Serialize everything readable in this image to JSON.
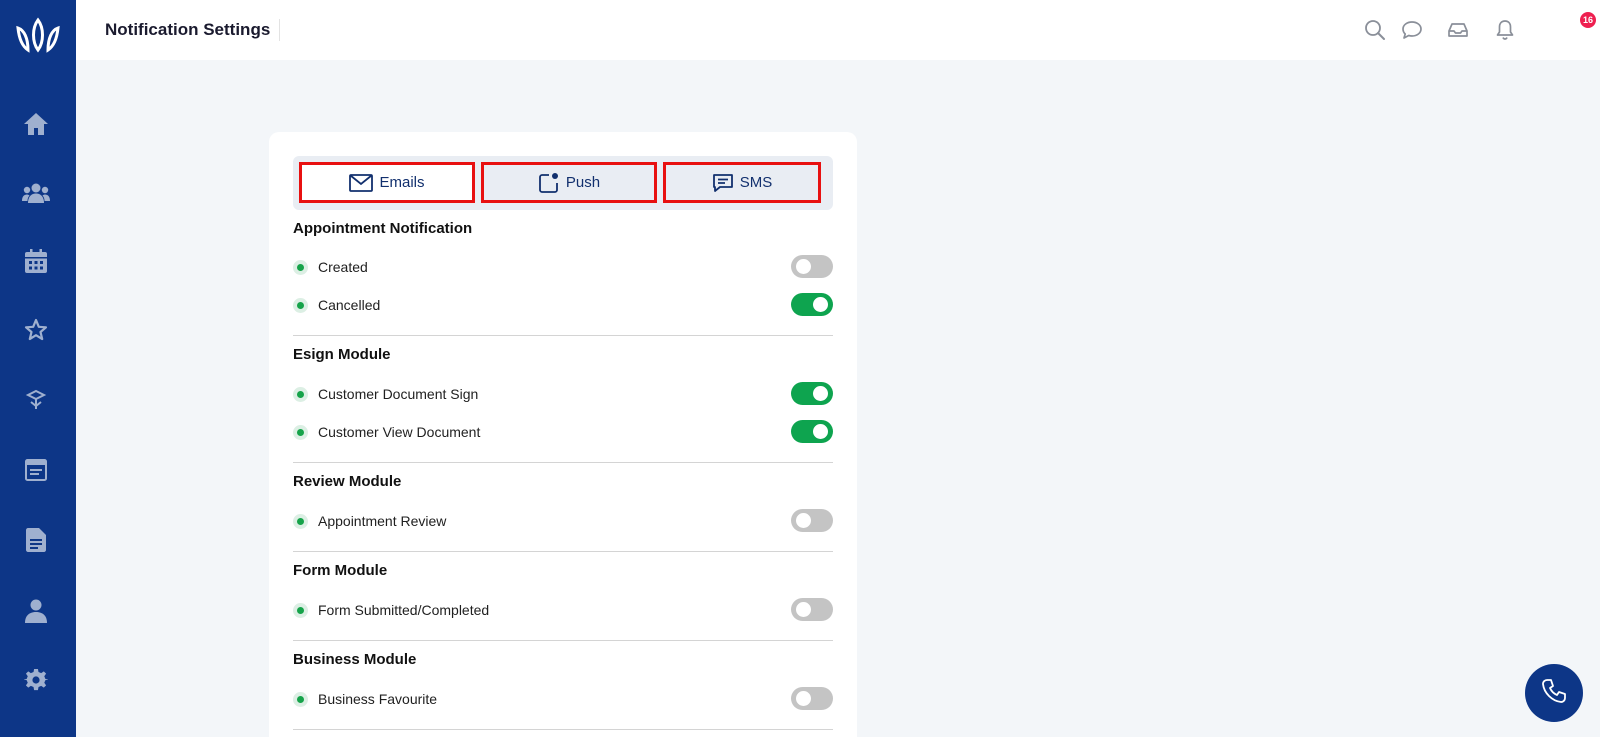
{
  "header": {
    "title": "Notification Settings",
    "notification_count": "16"
  },
  "sidebar": {
    "items": [
      {
        "icon": "home-icon"
      },
      {
        "icon": "users-icon"
      },
      {
        "icon": "calendar-icon"
      },
      {
        "icon": "star-icon"
      },
      {
        "icon": "box-icon"
      },
      {
        "icon": "browser-window-icon"
      },
      {
        "icon": "document-icon"
      },
      {
        "icon": "person-icon"
      },
      {
        "icon": "gear-icon"
      }
    ]
  },
  "tabs": [
    {
      "label": "Emails",
      "icon": "mail-icon",
      "active": true
    },
    {
      "label": "Push",
      "icon": "push-notification-icon",
      "active": false
    },
    {
      "label": "SMS",
      "icon": "chat-message-icon",
      "active": false
    }
  ],
  "sections": [
    {
      "title": "Appointment Notification",
      "items": [
        {
          "label": "Created",
          "enabled": false
        },
        {
          "label": "Cancelled",
          "enabled": true
        }
      ]
    },
    {
      "title": "Esign Module",
      "items": [
        {
          "label": "Customer Document Sign",
          "enabled": true
        },
        {
          "label": "Customer View Document",
          "enabled": true
        }
      ]
    },
    {
      "title": "Review Module",
      "items": [
        {
          "label": "Appointment Review",
          "enabled": false
        }
      ]
    },
    {
      "title": "Form Module",
      "items": [
        {
          "label": "Form Submitted/Completed",
          "enabled": false
        }
      ]
    },
    {
      "title": "Business Module",
      "items": [
        {
          "label": "Business Favourite",
          "enabled": false
        }
      ]
    }
  ],
  "colors": {
    "sidebar": "#0d3687",
    "toggle_on": "#0ea44f",
    "toggle_off": "#c4c4c4",
    "tab_highlight": "#e81010",
    "badge": "#ee2050"
  }
}
